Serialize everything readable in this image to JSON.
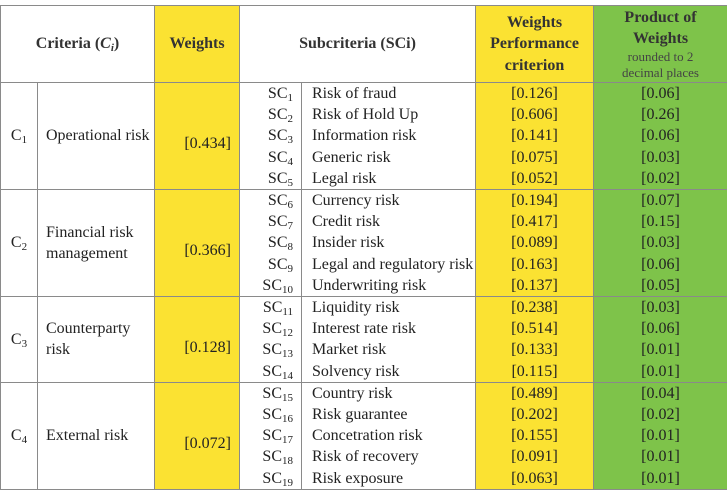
{
  "header": {
    "criteria": "Criteria (",
    "criteria_sym": "C",
    "criteria_sub": "i",
    "criteria_close": ")",
    "weights": "Weights",
    "subcriteria": "Subcriteria (SCi)",
    "perf_line1": "Weights",
    "perf_line2": "Performance",
    "perf_line3": "criterion",
    "product_line1": "Product of",
    "product_line2": "Weights",
    "product_note1": "rounded to 2",
    "product_note2": "decimal places"
  },
  "colors": {
    "yellow": "#fbe232",
    "green": "#7ec34a",
    "border": "#8a8a8a"
  },
  "groups": [
    {
      "code": "C",
      "code_sub": "1",
      "name": "Operational risk",
      "weight": "[0.434]",
      "subcriteria": [
        {
          "code": "SC",
          "sub": "1",
          "name": "Risk of fraud",
          "perf": "[0.126]",
          "product": "[0.06]"
        },
        {
          "code": "SC",
          "sub": "2",
          "name": "Risk of  Hold Up",
          "perf": "[0.606]",
          "product": "[0.26]"
        },
        {
          "code": "SC",
          "sub": "3",
          "name": "Information risk",
          "perf": "[0.141]",
          "product": "[0.06]"
        },
        {
          "code": "SC",
          "sub": "4",
          "name": "Generic risk",
          "perf": "[0.075]",
          "product": "[0.03]"
        },
        {
          "code": "SC",
          "sub": "5",
          "name": "Legal risk",
          "perf": "[0.052]",
          "product": "[0.02]"
        }
      ]
    },
    {
      "code": "C",
      "code_sub": "2",
      "name": "Financial risk management",
      "weight": "[0.366]",
      "subcriteria": [
        {
          "code": "SC",
          "sub": "6",
          "name": "Currency risk",
          "perf": "[0.194]",
          "product": "[0.07]"
        },
        {
          "code": "SC",
          "sub": "7",
          "name": "Credit risk",
          "perf": "[0.417]",
          "product": "[0.15]"
        },
        {
          "code": "SC",
          "sub": "8",
          "name": "Insider risk",
          "perf": "[0.089]",
          "product": "[0.03]"
        },
        {
          "code": "SC",
          "sub": "9",
          "name": "Legal and regulatory risk",
          "perf": "[0.163]",
          "product": "[0.06]"
        },
        {
          "code": "SC",
          "sub": "10",
          "name": "Underwriting risk",
          "perf": "[0.137]",
          "product": "[0.05]"
        }
      ]
    },
    {
      "code": "C",
      "code_sub": "3",
      "name": "Counterparty risk",
      "weight": "[0.128]",
      "subcriteria": [
        {
          "code": "SC",
          "sub": "11",
          "name": "Liquidity risk",
          "perf": "[0.238]",
          "product": "[0.03]"
        },
        {
          "code": "SC",
          "sub": "12",
          "name": "Interest rate risk",
          "perf": "[0.514]",
          "product": "[0.06]"
        },
        {
          "code": "SC",
          "sub": "13",
          "name": "Market risk",
          "perf": "[0.133]",
          "product": "[0.01]"
        },
        {
          "code": "SC",
          "sub": "14",
          "name": "Solvency risk",
          "perf": "[0.115]",
          "product": "[0.01]"
        }
      ]
    },
    {
      "code": "C",
      "code_sub": "4",
      "name": "External risk",
      "weight": "[0.072]",
      "subcriteria": [
        {
          "code": "SC",
          "sub": "15",
          "name": "Country risk",
          "perf": "[0.489]",
          "product": "[0.04]"
        },
        {
          "code": "SC",
          "sub": "16",
          "name": "Risk guarantee",
          "perf": "[0.202]",
          "product": "[0.02]"
        },
        {
          "code": "SC",
          "sub": "17",
          "name": "Concetration risk",
          "perf": "[0.155]",
          "product": "[0.01]"
        },
        {
          "code": "SC",
          "sub": "18",
          "name": "Risk of recovery",
          "perf": "[0.091]",
          "product": "[0.01]"
        },
        {
          "code": "SC",
          "sub": "19",
          "name": "Risk exposure",
          "perf": "[0.063]",
          "product": "[0.01]"
        }
      ]
    }
  ]
}
